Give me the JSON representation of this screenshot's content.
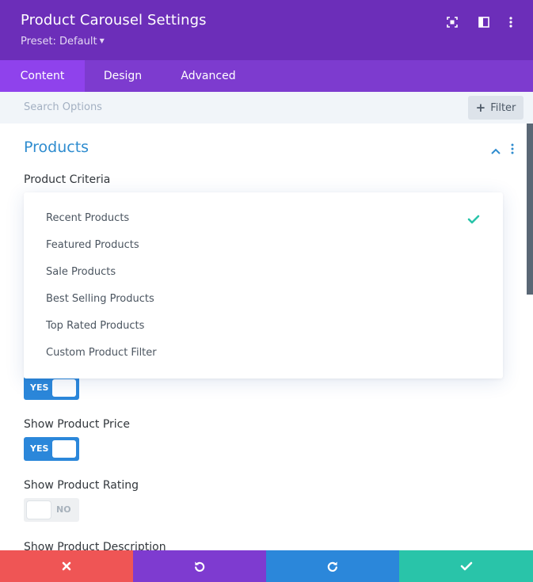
{
  "header": {
    "title": "Product Carousel Settings",
    "preset_label": "Preset: Default",
    "icons": [
      "expand-icon",
      "sidebar-layout-icon",
      "more-options-icon"
    ]
  },
  "tabs": [
    {
      "label": "Content",
      "active": true
    },
    {
      "label": "Design",
      "active": false
    },
    {
      "label": "Advanced",
      "active": false
    }
  ],
  "search": {
    "placeholder": "Search Options",
    "filter_label": "Filter"
  },
  "section": {
    "title": "Products",
    "collapsed": false
  },
  "product_criteria": {
    "label": "Product Criteria",
    "selected": "Recent Products",
    "options": [
      "Recent Products",
      "Featured Products",
      "Sale Products",
      "Best Selling Products",
      "Top Rated Products",
      "Custom Product Filter"
    ]
  },
  "toggles": [
    {
      "label": "",
      "state": "YES",
      "on": true
    },
    {
      "label": "Show Product Price",
      "state": "YES",
      "on": true
    },
    {
      "label": "Show Product Rating",
      "state": "NO",
      "on": false
    }
  ],
  "partial_label": "Show Product Description",
  "footer": {
    "buttons": [
      "close-icon",
      "undo-icon",
      "redo-icon",
      "check-icon"
    ]
  },
  "colors": {
    "header": "#6c2eb9",
    "tabs": "#7d3bcf",
    "active_tab": "#8f42ec",
    "accent_blue": "#2b87da",
    "section_title": "#2e8ccf",
    "cancel": "#ef5555",
    "undo": "#7e3bd0",
    "redo": "#2b87da",
    "save": "#29c4a9",
    "check": "#29c4a9"
  }
}
